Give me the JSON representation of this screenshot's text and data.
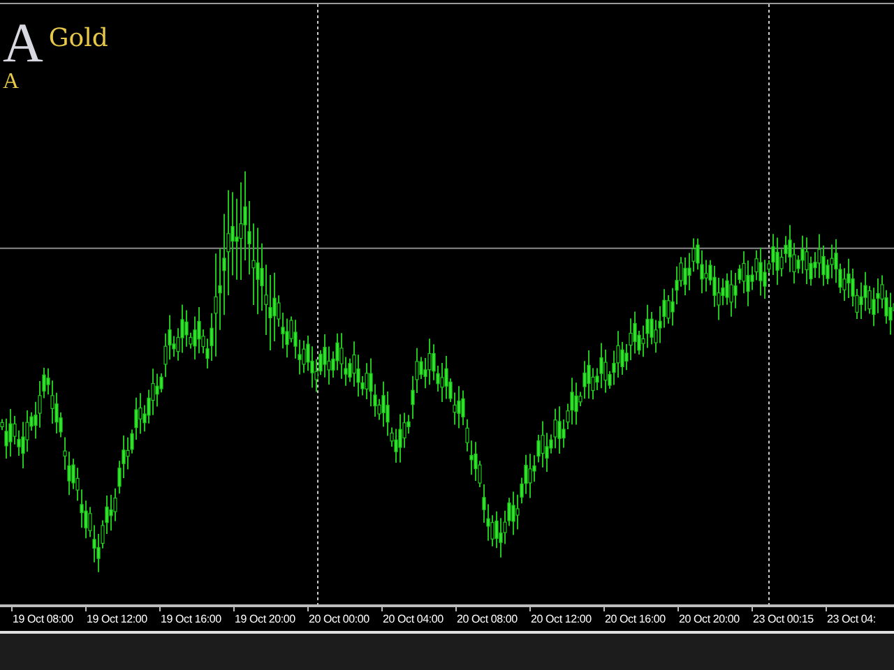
{
  "title": {
    "logo_letter": "A",
    "symbol": "Gold",
    "subtitle": "A"
  },
  "time_axis": [
    "19 Oct 08:00",
    "19 Oct 12:00",
    "19 Oct 16:00",
    "19 Oct 20:00",
    "20 Oct 00:00",
    "20 Oct 04:00",
    "20 Oct 08:00",
    "20 Oct 12:00",
    "20 Oct 16:00",
    "20 Oct 20:00",
    "23 Oct 00:15",
    "23 Oct 04:"
  ]
}
